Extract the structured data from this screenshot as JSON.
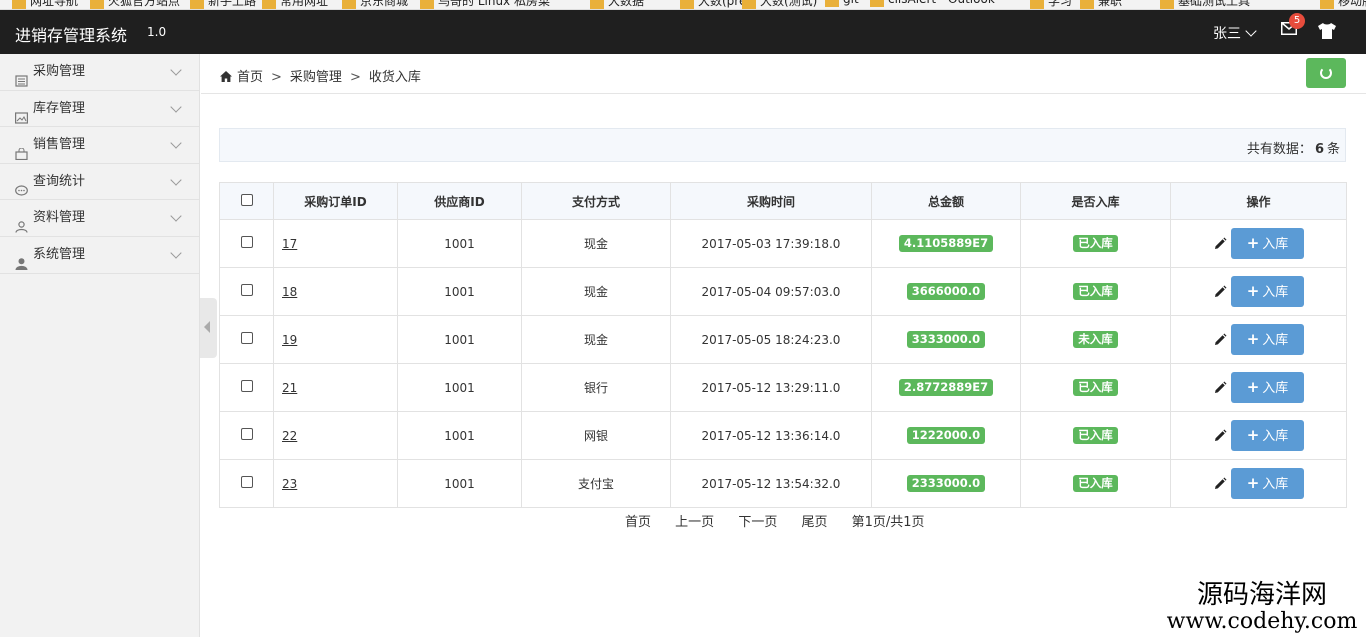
{
  "bookmarks": [
    "网址导航",
    "火狐官方站点",
    "新手上路",
    "常用网址",
    "京东商城",
    "鸟哥的 Linux 私房菜",
    "大数据",
    "大数(pre)",
    "大数(测试)",
    "git",
    "cilsAlert - Outlook",
    "学习",
    "兼职",
    "基础测试工具",
    "移动版书签"
  ],
  "navbar": {
    "brand": "进销存管理系统",
    "version": "1.0",
    "user": "张三",
    "mail_count": "5"
  },
  "sidebar": {
    "items": [
      {
        "label": "采购管理",
        "icon": "book-icon"
      },
      {
        "label": "库存管理",
        "icon": "picture-icon"
      },
      {
        "label": "销售管理",
        "icon": "shopping-bag-icon"
      },
      {
        "label": "查询统计",
        "icon": "comment-icon"
      },
      {
        "label": "资料管理",
        "icon": "user-outline-icon"
      },
      {
        "label": "系统管理",
        "icon": "user-icon"
      }
    ]
  },
  "breadcrumb": {
    "home": "首页",
    "level1": "采购管理",
    "level2": "收货入库",
    "sep": ">"
  },
  "summary": {
    "prefix": "共有数据：",
    "count": "6",
    "suffix": "条"
  },
  "table": {
    "headers": [
      "采购订单ID",
      "供应商ID",
      "支付方式",
      "采购时间",
      "总金额",
      "是否入库",
      "操作"
    ],
    "rows": [
      {
        "id": "17",
        "supplier": "1001",
        "payment": "现金",
        "time": "2017-05-03 17:39:18.0",
        "amount": "4.1105889E7",
        "status": "已入库"
      },
      {
        "id": "18",
        "supplier": "1001",
        "payment": "现金",
        "time": "2017-05-04 09:57:03.0",
        "amount": "3666000.0",
        "status": "已入库"
      },
      {
        "id": "19",
        "supplier": "1001",
        "payment": "现金",
        "time": "2017-05-05 18:24:23.0",
        "amount": "3333000.0",
        "status": "未入库"
      },
      {
        "id": "21",
        "supplier": "1001",
        "payment": "银行",
        "time": "2017-05-12 13:29:11.0",
        "amount": "2.8772889E7",
        "status": "已入库"
      },
      {
        "id": "22",
        "supplier": "1001",
        "payment": "网银",
        "time": "2017-05-12 13:36:14.0",
        "amount": "1222000.0",
        "status": "已入库"
      },
      {
        "id": "23",
        "supplier": "1001",
        "payment": "支付宝",
        "time": "2017-05-12 13:54:32.0",
        "amount": "2333000.0",
        "status": "已入库"
      }
    ],
    "action_label": "入库",
    "action_plus": "+"
  },
  "pager": {
    "first": "首页",
    "prev": "上一页",
    "next": "下一页",
    "last": "尾页",
    "info": "第1页/共1页"
  },
  "watermark": {
    "line1": "源码海洋网",
    "line2": "www.codehy.com"
  },
  "colors": {
    "navbar": "#1f1f1f",
    "label_green": "#5cb85c",
    "action_blue": "#5b9bd5",
    "badge_red": "#e74c3c"
  }
}
